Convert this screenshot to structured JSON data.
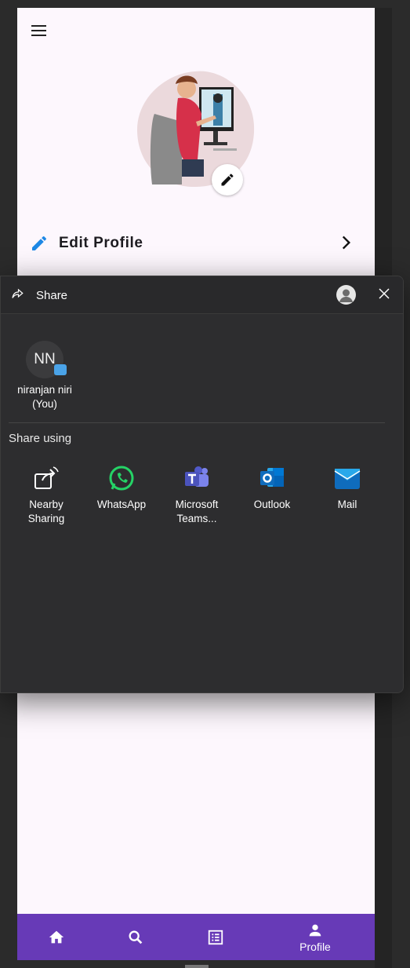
{
  "app": {
    "edit_profile_label": "Edit Profile",
    "bottom_nav": [
      {
        "icon": "home-icon",
        "label": ""
      },
      {
        "icon": "search-icon",
        "label": ""
      },
      {
        "icon": "list-icon",
        "label": ""
      },
      {
        "icon": "person-icon",
        "label": "Profile"
      }
    ],
    "colors": {
      "nav": "#673ab7",
      "accent_pencil": "#1e88e5",
      "background": "#fdf7fd"
    }
  },
  "share": {
    "title": "Share",
    "contact": {
      "initials": "NN",
      "name": "niranjan niri (You)"
    },
    "share_using_label": "Share using",
    "apps": [
      {
        "icon": "nearby-sharing-icon",
        "label": "Nearby Sharing"
      },
      {
        "icon": "whatsapp-icon",
        "label": "WhatsApp"
      },
      {
        "icon": "microsoft-teams-icon",
        "label": "Microsoft Teams..."
      },
      {
        "icon": "outlook-icon",
        "label": "Outlook"
      },
      {
        "icon": "mail-icon",
        "label": "Mail"
      }
    ]
  }
}
